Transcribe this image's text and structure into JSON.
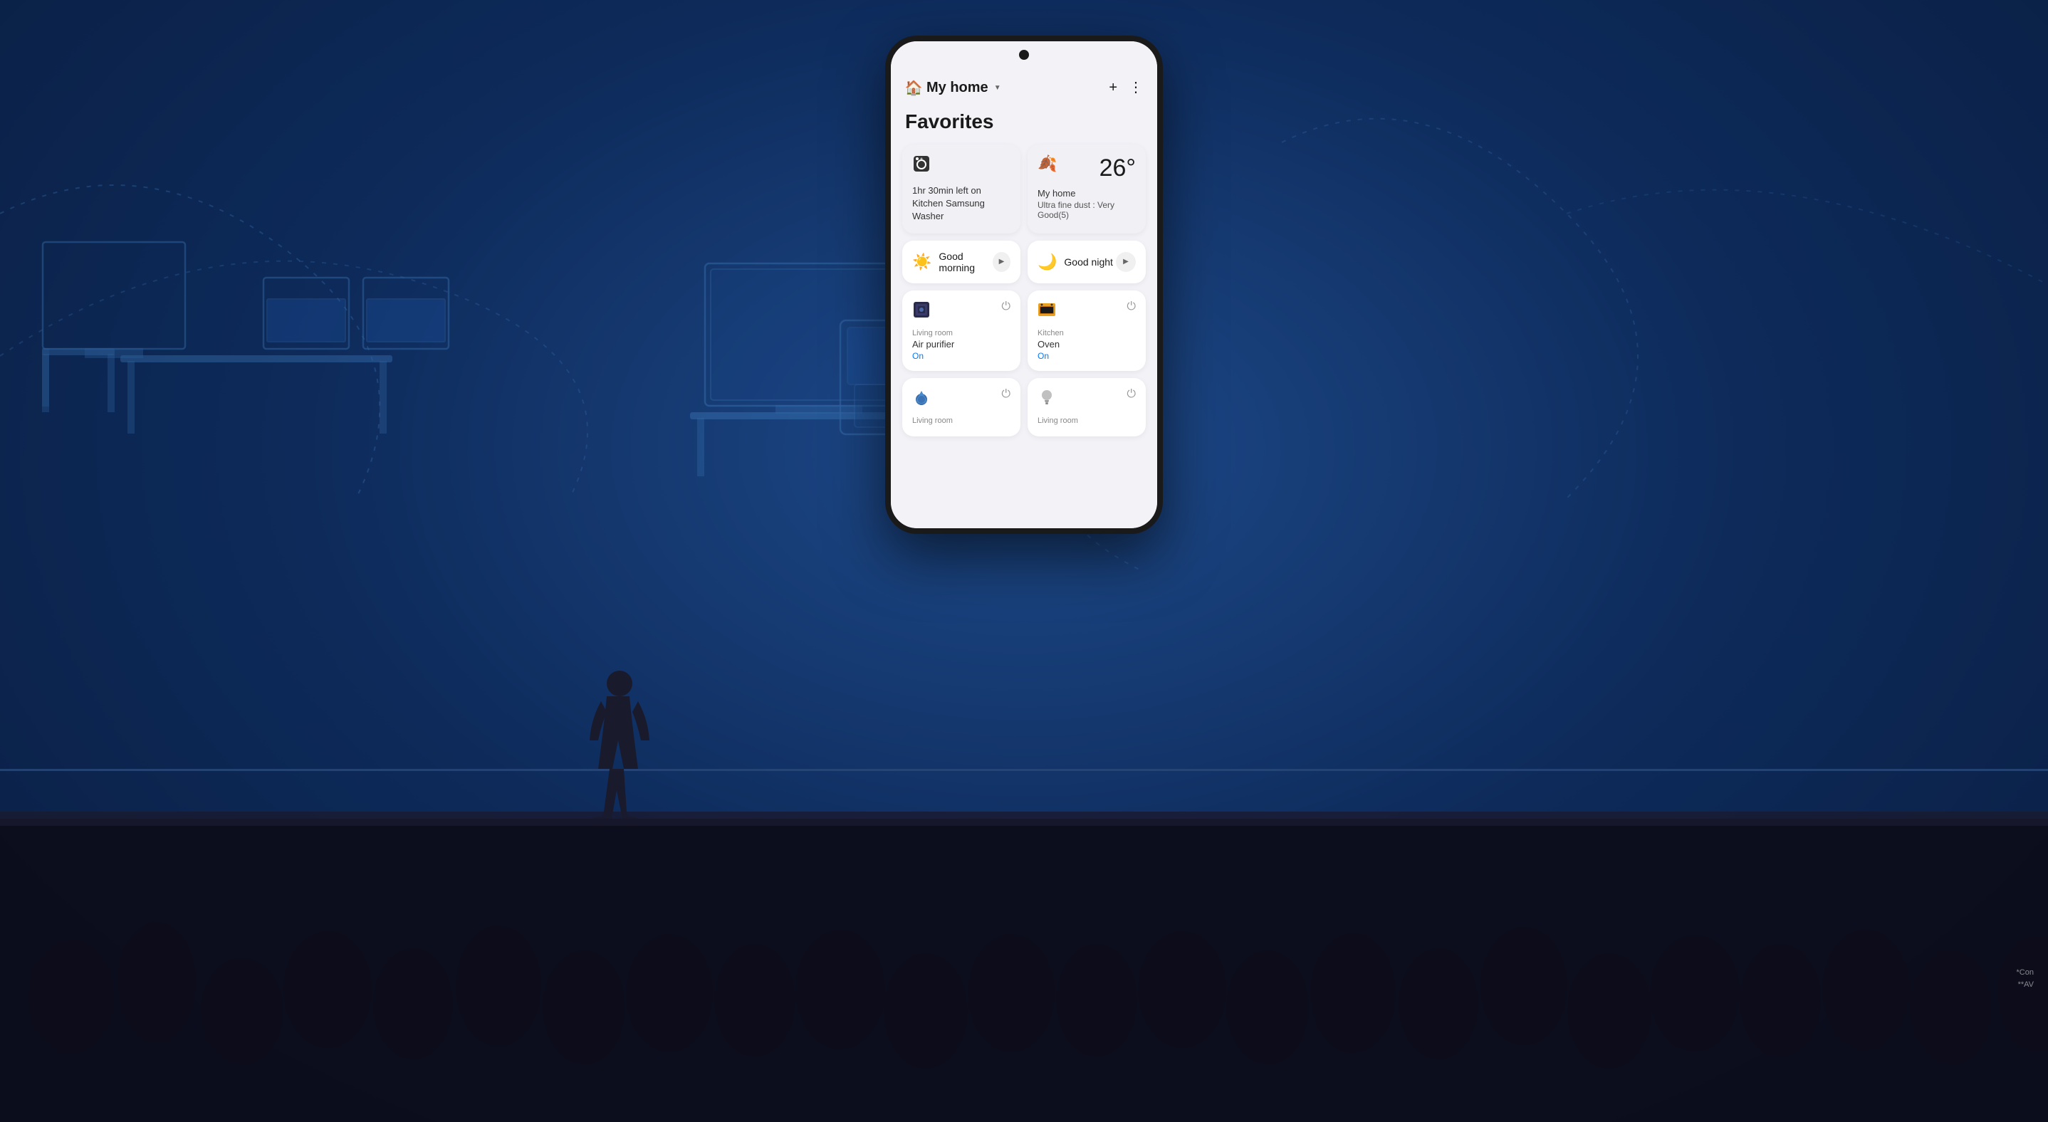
{
  "background": {
    "color": "#1a3a6b"
  },
  "app": {
    "header": {
      "title": "My home",
      "dropdown_label": "My home ▼",
      "add_button": "+",
      "more_button": "⋮",
      "home_icon": "🏠"
    },
    "favorites_title": "Favorites",
    "washer_card": {
      "icon": "🫧",
      "description": "1hr 30min left on Kitchen Samsung Washer"
    },
    "weather_card": {
      "icon": "🍂",
      "temperature": "26°",
      "location": "My home",
      "description": "Ultra fine dust : Very Good(5)"
    },
    "scene_morning": {
      "icon": "☀️",
      "label": "Good morning",
      "play_icon": "▶"
    },
    "scene_night": {
      "icon": "🌙",
      "label": "Good night",
      "play_icon": "▶"
    },
    "device_air_purifier": {
      "icon": "⬛",
      "location": "Living room",
      "name": "Air purifier",
      "status": "On",
      "power_icon": "⏻"
    },
    "device_oven": {
      "icon": "⬜",
      "location": "Kitchen",
      "name": "Oven",
      "status": "On",
      "power_icon": "⏻"
    },
    "device_humidifier": {
      "icon": "💧",
      "location": "Living room",
      "name": "",
      "power_icon": "⏻"
    },
    "device_light": {
      "icon": "💡",
      "location": "Living room",
      "name": "",
      "power_icon": "⏻"
    }
  },
  "disclaimer": {
    "line1": "*Con",
    "line2": "**AV"
  }
}
